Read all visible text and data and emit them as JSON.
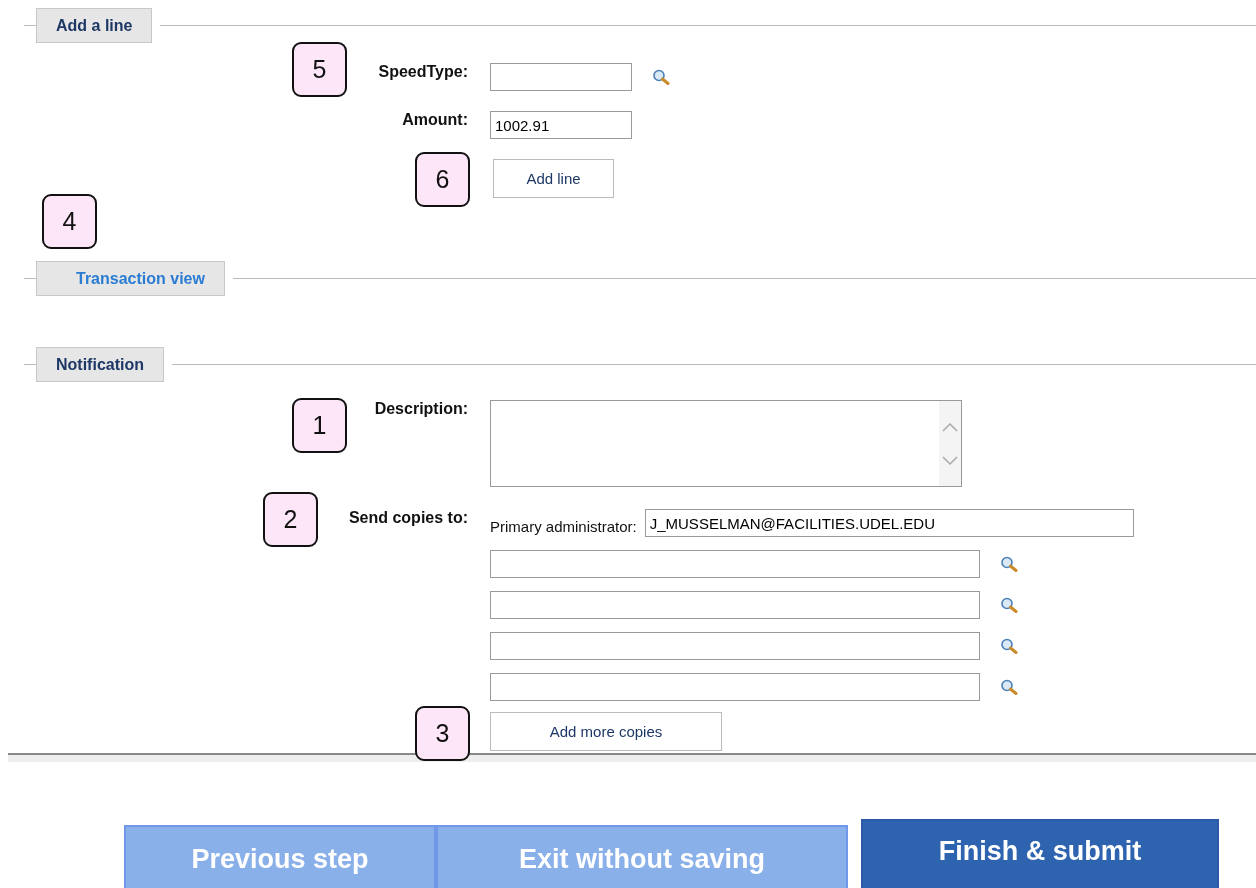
{
  "add_line": {
    "title": "Add a line",
    "fields": [
      {
        "label": "SpeedType:",
        "lookup": true
      },
      {
        "label": "Amount:",
        "value": "1002.91",
        "lookup": false
      }
    ],
    "button": "Add line"
  },
  "transaction_view": {
    "title": "Transaction view",
    "kind": "link"
  },
  "notification": {
    "title": "Notification",
    "description_label": "Description:",
    "copies_label": "Send copies to:",
    "primary_label": "Primary administrator:",
    "primary_value": "J_MUSSELMAN@FACILITIES.UDEL.EDU",
    "copies": [
      {
        "lookup": true
      },
      {
        "lookup": true
      },
      {
        "lookup": true
      },
      {
        "lookup": true
      }
    ],
    "button": "Add more copies"
  },
  "footer_buttons": [
    {
      "label": "Previous step",
      "kind": "secondary"
    },
    {
      "label": "Exit without saving",
      "kind": "secondary"
    },
    {
      "label": "Finish & submit",
      "kind": "primary"
    }
  ],
  "callouts": [
    "5",
    "6",
    "4",
    "1",
    "2",
    "3"
  ]
}
